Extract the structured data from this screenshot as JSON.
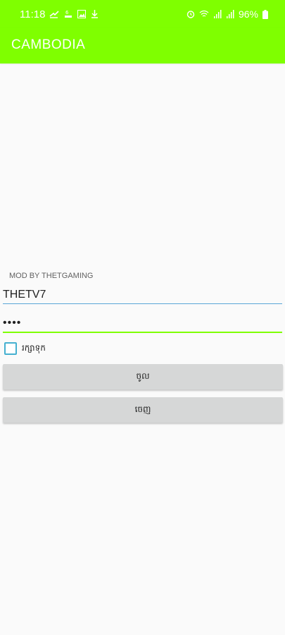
{
  "status_bar": {
    "time": "11:18",
    "battery": "96%"
  },
  "app_bar": {
    "title": "CAMBODIA",
    "color": "#7fff00"
  },
  "form": {
    "mod_label": "MOD BY THETGAMING",
    "username_value": "THETV7",
    "password_value": "••••",
    "remember_label": "រក្សាទុក",
    "remember_checked": false,
    "login_button": "ចូល",
    "exit_button": "ចេញ"
  }
}
